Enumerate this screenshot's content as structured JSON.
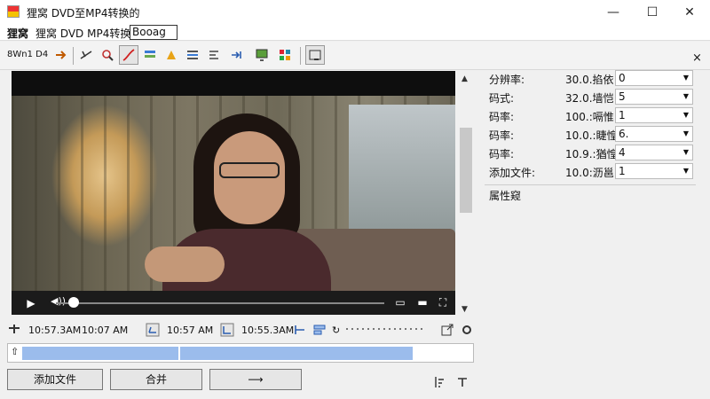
{
  "window": {
    "title": "狸窝 DVD至MP4转换的",
    "controls": {
      "minimize": "—",
      "maximize": "☐",
      "close": "✕"
    }
  },
  "menubar": {
    "items": [
      "狸窝",
      "狸窝 DVD MP4转换的"
    ],
    "search_value": "Booag"
  },
  "toolbar": {
    "label": "8Wn1 D4",
    "close": "×"
  },
  "player": {
    "play": "▶",
    "volume": "◀))"
  },
  "timecodes": {
    "t1": "10:57.3AM",
    "t2": "10:07 AM",
    "t3": "10:57 AM",
    "t4": "10:55.3AM"
  },
  "buttons": {
    "add_file": "添加文件",
    "merge": "合并",
    "arrow": "⟶"
  },
  "properties": {
    "rows": [
      {
        "label": "分辨率:",
        "value": "30.0.掐依",
        "field": "0"
      },
      {
        "label": "码式:",
        "value": "32.0.墙恺",
        "field": "5"
      },
      {
        "label": "码率:",
        "value": "100.:嗝惟",
        "field": "1"
      },
      {
        "label": "码率:",
        "value": "10.0.:睫惶",
        "field": "6."
      },
      {
        "label": "码率:",
        "value": "10.9.:猶惶",
        "field": "4"
      },
      {
        "label": "添加文件:",
        "value": "10.0:沥邕",
        "field": "1"
      }
    ],
    "section_title": "属性窥"
  }
}
